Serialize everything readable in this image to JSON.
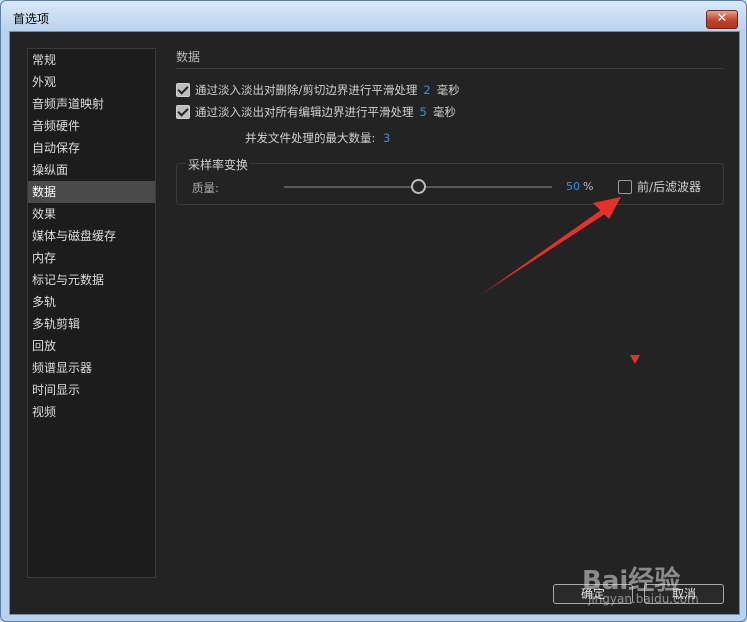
{
  "window": {
    "title": "首选项",
    "close_label": "✕"
  },
  "sidebar": {
    "items": [
      {
        "label": "常规"
      },
      {
        "label": "外观"
      },
      {
        "label": "音频声道映射"
      },
      {
        "label": "音频硬件"
      },
      {
        "label": "自动保存"
      },
      {
        "label": "操纵面"
      },
      {
        "label": "数据",
        "active": true
      },
      {
        "label": "效果"
      },
      {
        "label": "媒体与磁盘缓存"
      },
      {
        "label": "内存"
      },
      {
        "label": "标记与元数据"
      },
      {
        "label": "多轨"
      },
      {
        "label": "多轨剪辑"
      },
      {
        "label": "回放"
      },
      {
        "label": "频谱显示器"
      },
      {
        "label": "时间显示"
      },
      {
        "label": "视频"
      }
    ]
  },
  "main": {
    "title": "数据",
    "options": [
      {
        "label": "通过淡入淡出对删除/剪切边界进行平滑处理",
        "value": "2",
        "unit": "毫秒",
        "checked": true
      },
      {
        "label": "通过淡入淡出对所有编辑边界进行平滑处理",
        "value": "5",
        "unit": "毫秒",
        "checked": true
      }
    ],
    "concurrency_label": "并发文件处理的最大数量:",
    "concurrency_value": "3",
    "resample": {
      "group_title": "采样率变换",
      "quality_label": "质量:",
      "quality_value": "50",
      "quality_fraction": 0.5,
      "quality_unit": "%",
      "filter_label": "前/后滤波器",
      "filter_checked": false
    }
  },
  "buttons": {
    "ok": "确定",
    "cancel": "取消"
  },
  "watermark": {
    "brand": "Bai经验",
    "url": "jingyan.baidu.com"
  },
  "colors": {
    "accent_value": "#3c8fe0",
    "arrow": "#e8302b"
  }
}
